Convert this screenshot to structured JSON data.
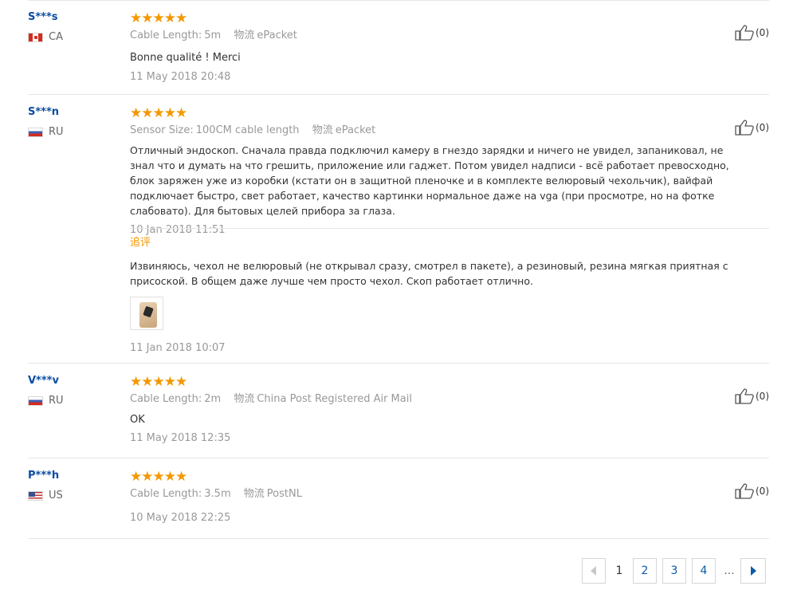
{
  "reviews": [
    {
      "user": "S***s",
      "country": "CA",
      "rating": "★★★★★",
      "meta": [
        {
          "key": "Cable Length:",
          "value": "5m"
        },
        {
          "key": "物流",
          "value": "ePacket"
        }
      ],
      "text": "Bonne qualité ! Merci",
      "date": "11 May 2018 20:48",
      "likes": "(0)"
    },
    {
      "user": "S***n",
      "country": "RU",
      "rating": "★★★★★",
      "meta": [
        {
          "key": "Sensor Size:",
          "value": "100CM cable length"
        },
        {
          "key": "物流",
          "value": "ePacket"
        }
      ],
      "text": "Отличный эндоскоп. Сначала правда подключил камеру в гнездо зарядки и ничего не увидел, запаниковал, не знал что и думать на что грешить, приложение или гаджет. Потом увидел надписи - всё работает превосходно, блок заряжен уже из коробки (кстати он в защитной пленочке и в комплекте велюровый чехольчик), вайфай подключает быстро, свет работает, качество картинки нормальное даже на vga (при просмотре, но на фотке слабовато). Для бытовых целей прибора за глаза.",
      "date": "10 Jan 2018 11:51",
      "likes": "(0)",
      "followup": {
        "title": "追评",
        "text": "Извиняюсь, чехол не велюровый (не открывал сразу, смотрел в пакете), а резиновый, резина мягкая приятная с присоской. В общем даже лучше чем просто чехол. Скоп работает отлично.",
        "date": "11 Jan 2018 10:07"
      }
    },
    {
      "user": "V***v",
      "country": "RU",
      "rating": "★★★★★",
      "meta": [
        {
          "key": "Cable Length:",
          "value": "2m"
        },
        {
          "key": "物流",
          "value": "China Post Registered Air Mail"
        }
      ],
      "text": "OK",
      "date": "11 May 2018 12:35",
      "likes": "(0)"
    },
    {
      "user": "P***h",
      "country": "US",
      "rating": "★★★★★",
      "meta": [
        {
          "key": "Cable Length:",
          "value": "3.5m"
        },
        {
          "key": "物流",
          "value": "PostNL"
        }
      ],
      "text": "",
      "date": "10 May 2018 22:25",
      "likes": "(0)"
    }
  ],
  "pagination": {
    "prev_icon": "chevron-left-icon",
    "current": "1",
    "pages": [
      "2",
      "3",
      "4"
    ],
    "ellipsis": "...",
    "next_icon": "chevron-right-icon"
  },
  "colors": {
    "star": "#f39800",
    "username": "#0b4da2",
    "followup_title": "#f39800",
    "page_link": "#0b5ba8"
  },
  "icons": {
    "like": "thumbs-up-icon"
  }
}
